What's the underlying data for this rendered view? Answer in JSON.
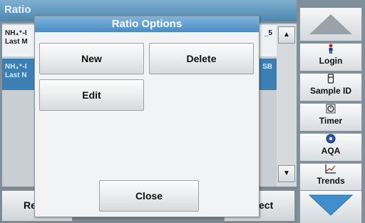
{
  "screen": {
    "title": "Ratio"
  },
  "list": {
    "rows": [
      {
        "line1": "NH₄⁺-I",
        "line2": "Last M",
        "right": "_5"
      },
      {
        "line1": "NH₄⁺-I",
        "line2": "Last N",
        "right": "SB"
      }
    ]
  },
  "bottom_bar": {
    "left_label": "Re",
    "right_label": "ect"
  },
  "side_panel": {
    "buttons": [
      {
        "label": "Login",
        "icon": "person-icon"
      },
      {
        "label": "Sample ID",
        "icon": "vial-icon"
      },
      {
        "label": "Timer",
        "icon": "clock-icon"
      },
      {
        "label": "AQA",
        "icon": "globe-icon"
      },
      {
        "label": "Trends",
        "icon": "chart-icon"
      }
    ]
  },
  "dialog": {
    "title": "Ratio Options",
    "new_label": "New",
    "delete_label": "Delete",
    "edit_label": "Edit",
    "close_label": "Close"
  },
  "colors": {
    "accent": "#4a8cc2",
    "selected_row": "#3c7fb2"
  }
}
